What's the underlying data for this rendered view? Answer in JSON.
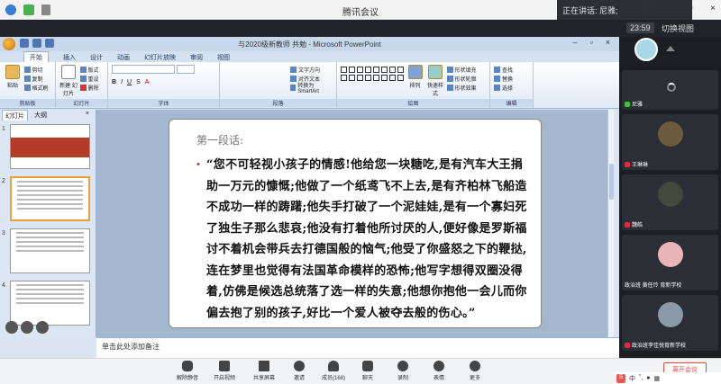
{
  "meeting": {
    "title": "腾讯会议",
    "speaking": "正在讲话: 尼雅;",
    "time": "23:59",
    "switch_view": "切换视图",
    "end_button": "离开会议"
  },
  "ppt": {
    "doc_title": "与2020级新教师 共勉 - Microsoft PowerPoint",
    "tabs": [
      "开始",
      "插入",
      "设计",
      "动画",
      "幻灯片放映",
      "审阅",
      "视图"
    ],
    "ribbon": {
      "paste": "粘贴",
      "cut": "剪切",
      "copy": "复制",
      "format_painter": "格式刷",
      "new_slide": "新建\n幻灯片",
      "layout": "版式",
      "reset": "重设",
      "delete": "删除",
      "text_direction": "文字方向",
      "align_text": "对齐文本",
      "smartart": "转换为 SmartArt",
      "arrange": "排列",
      "quick_styles": "快速样式",
      "shape_fill": "形状填充",
      "shape_outline": "形状轮廓",
      "shape_effects": "形状效果",
      "find": "查找",
      "replace": "替换",
      "select": "选择",
      "groups": [
        "剪贴板",
        "幻灯片",
        "字体",
        "段落",
        "绘图",
        "编辑"
      ]
    },
    "panel_tabs": [
      "幻灯片",
      "大纲"
    ],
    "panel_close": "×",
    "slide_numbers": [
      "1",
      "2",
      "3",
      "4"
    ],
    "slide": {
      "heading": "第一段话:",
      "bullet": "•",
      "body": "“您不可轻视小孩子的情感!他给您一块糖吃,是有汽车大王捐助一万元的慷慨;他做了一个纸鸢飞不上去,是有齐柏林飞船造不成功一样的踌躇;他失手打破了一个泥娃娃,是有一个寡妇死了独生子那么悲哀;他没有打着他所讨厌的人,便好像是罗斯福讨不着机会带兵去打德国般的恼气;他受了你盛怒之下的鞭挞,连在梦里也觉得有法国革命模样的恐怖;他写字想得双圈没得着,仿佛是候选总统落了选一样的失意;他想你抱他一会儿而你偏去抱了别的孩子,好比一个爱人被夺去般的伤心。”"
    },
    "notes_placeholder": "单击此处添加备注"
  },
  "participants": [
    {
      "name": "尼雅",
      "mic": "on"
    },
    {
      "name": "王琳琳",
      "mic": "muted"
    },
    {
      "name": "魏皓",
      "mic": "muted"
    },
    {
      "name": "政治班 黄任玲 育新学校",
      "mic": "none"
    },
    {
      "name": "政治班李佳悦育新学校",
      "mic": "muted"
    }
  ],
  "toolbar": [
    {
      "label": "解除静音",
      "icon": "mic-muted-icon"
    },
    {
      "label": "开启视频",
      "icon": "camera-off-icon"
    },
    {
      "label": "共享屏幕",
      "icon": "screen-share-icon"
    },
    {
      "label": "邀请",
      "icon": "invite-icon"
    },
    {
      "label": "成员(168)",
      "icon": "members-icon"
    },
    {
      "label": "聊天",
      "icon": "chat-icon"
    },
    {
      "label": "录制",
      "icon": "record-icon"
    },
    {
      "label": "表情",
      "icon": "emoji-icon"
    },
    {
      "label": "更多",
      "icon": "more-icon"
    }
  ],
  "ime": {
    "logo": "S",
    "lang": "中"
  },
  "colors": {
    "accent_red": "#e44444",
    "slide_bullet": "#c0392b",
    "selected_thumb": "#f0a030"
  }
}
